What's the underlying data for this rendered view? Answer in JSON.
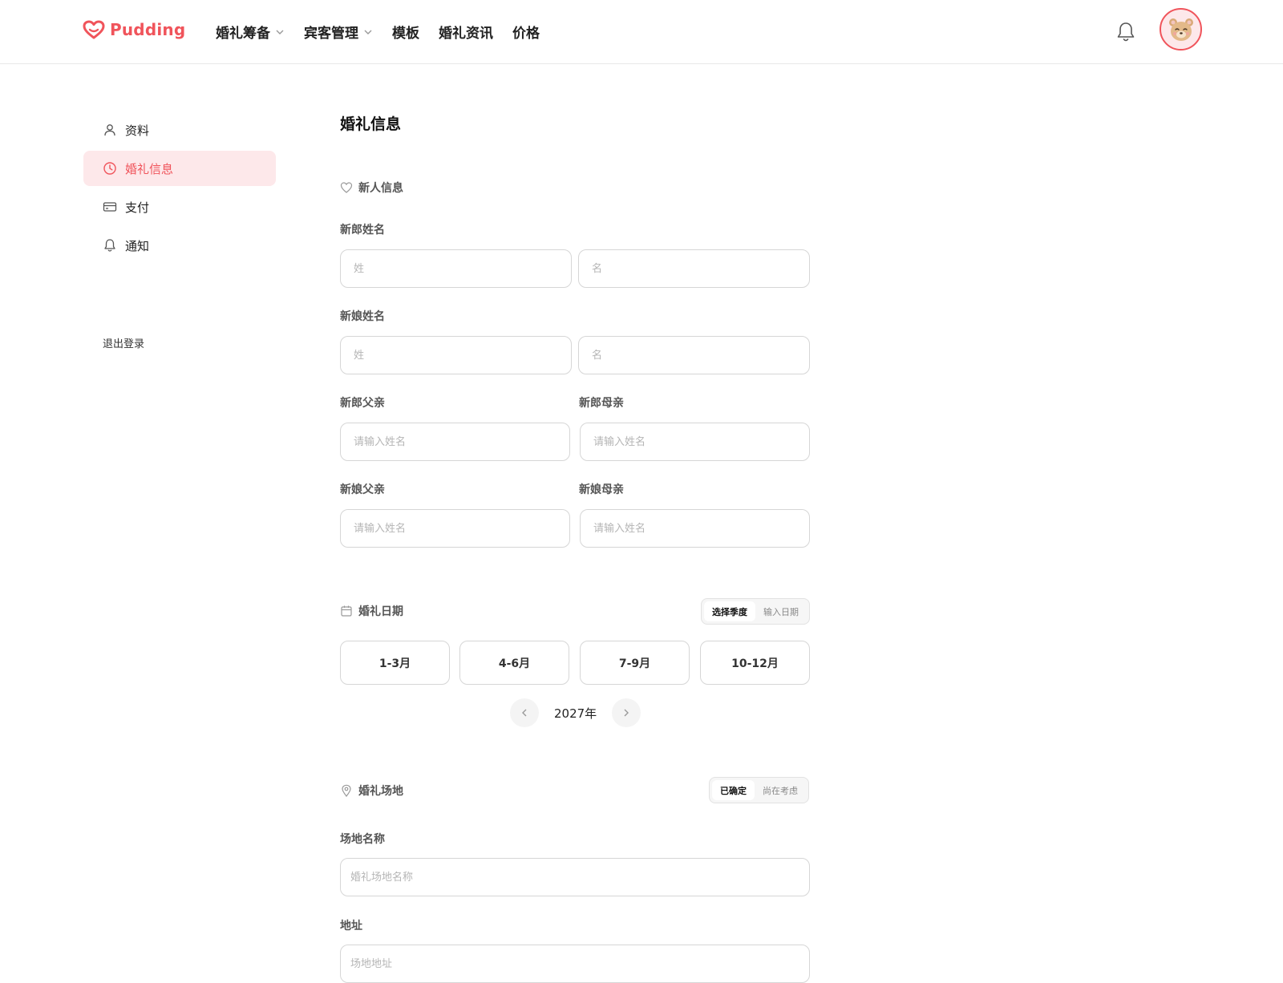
{
  "brand": {
    "name": "Pudding",
    "accent": "#f0545b"
  },
  "nav": {
    "items": [
      {
        "label": "婚礼筹备",
        "dropdown": true
      },
      {
        "label": "宾客管理",
        "dropdown": true
      },
      {
        "label": "模板",
        "dropdown": false
      },
      {
        "label": "婚礼资讯",
        "dropdown": false
      },
      {
        "label": "价格",
        "dropdown": false
      }
    ]
  },
  "sidebar": {
    "items": [
      {
        "label": "资料",
        "icon": "user-icon",
        "active": false
      },
      {
        "label": "婚礼信息",
        "icon": "clock-icon",
        "active": true
      },
      {
        "label": "支付",
        "icon": "card-icon",
        "active": false
      },
      {
        "label": "通知",
        "icon": "bell-icon",
        "active": false
      }
    ],
    "logout": "退出登录"
  },
  "main": {
    "title": "婚礼信息",
    "couple": {
      "heading": "新人信息",
      "groom_label": "新郎姓名",
      "bride_label": "新娘姓名",
      "last_placeholder": "姓",
      "first_placeholder": "名",
      "groom_father_label": "新郎父亲",
      "groom_mother_label": "新郎母亲",
      "bride_father_label": "新娘父亲",
      "bride_mother_label": "新娘母亲",
      "name_placeholder": "请输入姓名"
    },
    "date": {
      "heading": "婚礼日期",
      "toggle": [
        "选择季度",
        "输入日期"
      ],
      "selected_toggle": "选择季度",
      "quarters": [
        "1-3月",
        "4-6月",
        "7-9月",
        "10-12月"
      ],
      "year": "2027年"
    },
    "venue": {
      "heading": "婚礼场地",
      "toggle": [
        "已确定",
        "尚在考虑"
      ],
      "selected_toggle": "已确定",
      "name_label": "场地名称",
      "name_placeholder": "婚礼场地名称",
      "address_label": "地址",
      "address_placeholder": "场地地址"
    }
  }
}
